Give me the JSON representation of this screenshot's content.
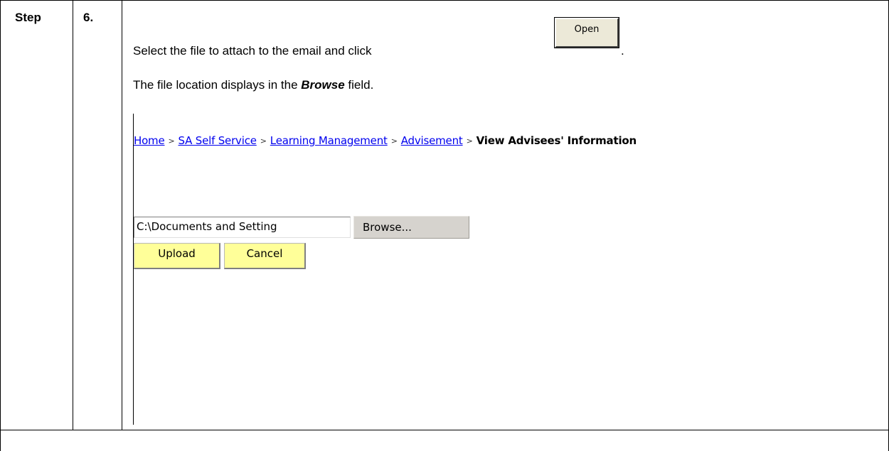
{
  "step": {
    "label": "Step",
    "number": "6."
  },
  "instructions": {
    "line1": "Select the file to attach to the email and click",
    "line1_button": "Open",
    "line1_end": ".",
    "line2_pre": "The file location displays in the ",
    "line2_bold": "Browse",
    "line2_post": " field."
  },
  "breadcrumb": {
    "items": [
      "Home",
      "SA Self Service",
      "Learning Management",
      "Advisement"
    ],
    "current": "View Advisees' Information",
    "separator": ">"
  },
  "upload": {
    "file_value": "C:\\Documents and Setting",
    "browse_label": "Browse...",
    "upload_label": "Upload",
    "cancel_label": "Cancel"
  },
  "colors": {
    "link": "#0000ee",
    "yellow_button": "#ffff99",
    "grey_button": "#d6d3ce"
  }
}
